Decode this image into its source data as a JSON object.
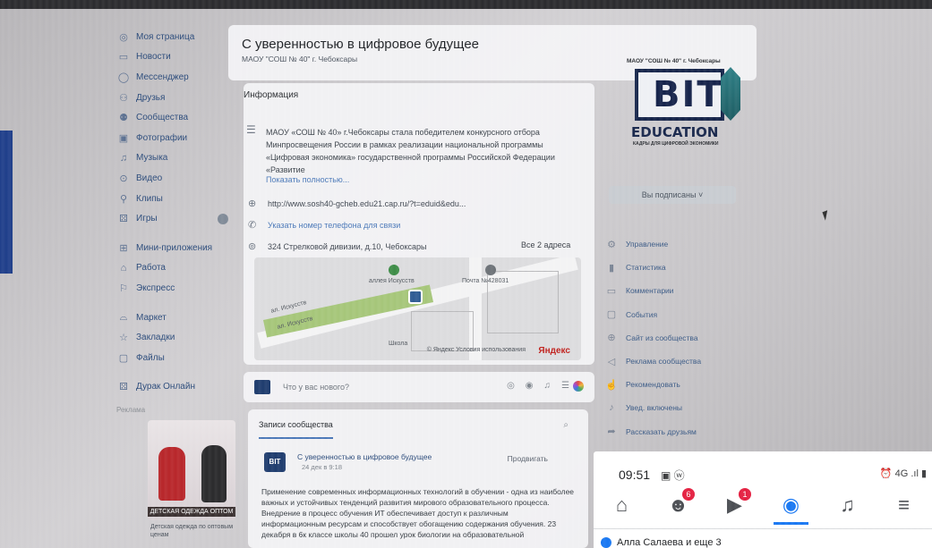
{
  "nav": {
    "items": [
      {
        "label": "Моя страница",
        "icon": "user-circle-icon"
      },
      {
        "label": "Новости",
        "icon": "news-icon"
      },
      {
        "label": "Мессенджер",
        "icon": "chat-icon"
      },
      {
        "label": "Друзья",
        "icon": "friends-icon"
      },
      {
        "label": "Сообщества",
        "icon": "communities-icon"
      },
      {
        "label": "Фотографии",
        "icon": "photo-icon"
      },
      {
        "label": "Музыка",
        "icon": "music-icon"
      },
      {
        "label": "Видео",
        "icon": "video-icon"
      },
      {
        "label": "Клипы",
        "icon": "clips-icon"
      },
      {
        "label": "Игры",
        "icon": "games-icon"
      }
    ],
    "items2": [
      {
        "label": "Мини-приложения",
        "icon": "apps-icon"
      },
      {
        "label": "Работа",
        "icon": "briefcase-icon"
      },
      {
        "label": "Экспресс",
        "icon": "express-icon"
      }
    ],
    "items3": [
      {
        "label": "Маркет",
        "icon": "bag-icon"
      },
      {
        "label": "Закладки",
        "icon": "star-icon"
      },
      {
        "label": "Файлы",
        "icon": "file-icon"
      }
    ],
    "game_item": "Дурак Онлайн",
    "ads_label": "Реклама",
    "ad_caption": "ДЕТСКАЯ ОДЕЖДА ОПТОМ",
    "ad_text": "Детская одежда по оптовым ценам"
  },
  "header": {
    "title": "С уверенностью в цифровое будущее",
    "subtitle": "МАОУ \"СОШ № 40\" г. Чебоксары"
  },
  "info": {
    "section_title": "Информация",
    "description": "МАОУ «СОШ № 40» г.Чебоксары стала победителем конкурсного отбора Минпросвещения России в рамках реализации национальной программы «Цифровая экономика» государственной программы Российской Федерации «Развитие",
    "show_more": "Показать полностью...",
    "website": "http://www.sosh40-gcheb.edu21.cap.ru/?t=eduid&edu...",
    "phone": "Указать номер телефона для связи",
    "address": "324 Стрелковой дивизии, д.10, Чебоксары",
    "all_addresses": "Все 2 адреса"
  },
  "map": {
    "street1": "ал. Искусств",
    "street2": "ал. Искусств",
    "poi1": "аллея Искусств",
    "poi2": "Почта №428031",
    "poi3": "Школа",
    "copyright": "© Яндекс Условия использования",
    "brand": "Яндекс"
  },
  "composer": {
    "placeholder": "Что у вас нового?"
  },
  "wall": {
    "tab": "Записи сообщества",
    "post": {
      "avatar_text": "BIT",
      "author": "С уверенностью в цифровое будущее",
      "date": "24 дек в 9:18",
      "promote": "Продвигать",
      "text": "Применение современных информационных технологий в обучении - одна из наиболее важных и устойчивых тенденций развития мирового образовательного процесса. Внедрение в процесс обучения ИТ обеспечивает доступ к различным информационным ресурсам и способствует обогащению содержания обучения. 23 декабря в 6к классе школы 40 прошел урок биологии на образовательной"
    }
  },
  "right": {
    "logo_top": "МАОУ \"СОШ № 40\" г. Чебоксары",
    "logo_bit": "BIT",
    "logo_edu": "EDUCATION",
    "logo_sub": "КАДРЫ ДЛЯ ЦИФРОВОЙ ЭКОНОМИКИ",
    "subscribed": "Вы подписаны ˅",
    "menu": [
      {
        "label": "Управление",
        "icon": "gear-icon"
      },
      {
        "label": "Статистика",
        "icon": "stats-icon"
      },
      {
        "label": "Комментарии",
        "icon": "comment-icon"
      },
      {
        "label": "События",
        "icon": "event-icon"
      },
      {
        "label": "Сайт из сообщества",
        "icon": "globe-icon"
      },
      {
        "label": "Реклама сообщества",
        "icon": "ads-icon"
      },
      {
        "label": "Рекомендовать",
        "icon": "thumb-up-icon"
      },
      {
        "label": "Увед. включены",
        "icon": "bell-icon"
      },
      {
        "label": "Рассказать друзьям",
        "icon": "share-icon"
      }
    ]
  },
  "phone": {
    "time": "09:51",
    "status_icons": "▣ ⓦ",
    "system_icons": "⏰ 4G .ıl ▮",
    "tabs": [
      {
        "icon": "home-icon",
        "glyph": "⌂",
        "badge": ""
      },
      {
        "icon": "groups-icon",
        "glyph": "☻",
        "badge": "6"
      },
      {
        "icon": "watch-icon",
        "glyph": "▶",
        "badge": "1"
      },
      {
        "icon": "profile-icon",
        "glyph": "◉",
        "badge": ""
      },
      {
        "icon": "notifications-icon",
        "glyph": "♫",
        "badge": ""
      },
      {
        "icon": "menu-icon",
        "glyph": "≡",
        "badge": ""
      }
    ],
    "notification": "Алла Салаева и еще 3"
  },
  "colors": {
    "vk_blue": "#4a78b8",
    "fb_blue": "#1877f2",
    "badge_red": "#e41e3f"
  }
}
